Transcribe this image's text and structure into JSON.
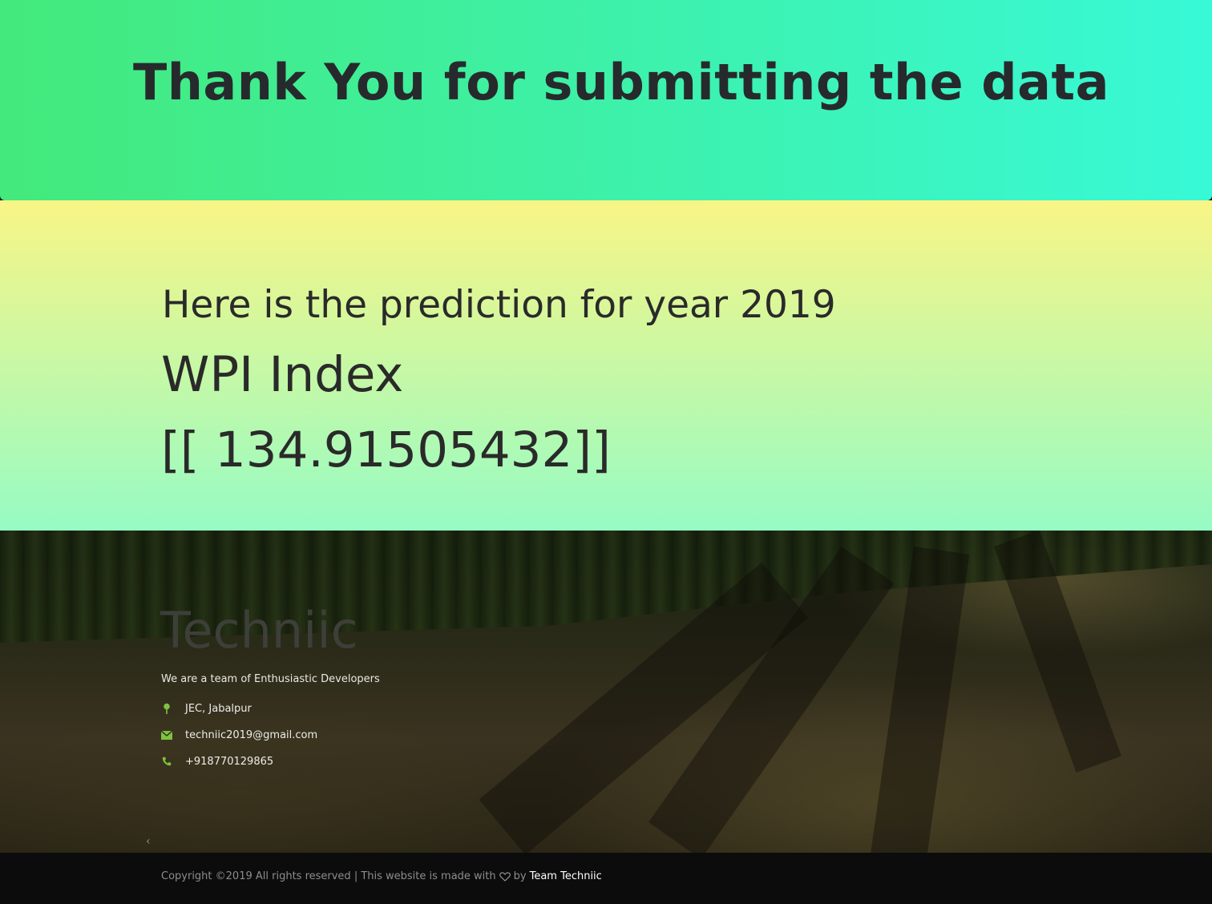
{
  "banner": {
    "title": "Thank You for submitting the data"
  },
  "prediction": {
    "intro": "Here is the prediction for year 2019",
    "label": "WPI Index",
    "value": "[[ 134.91505432]]"
  },
  "footer": {
    "brand": "Techniic",
    "tagline": "We are a team of Enthusiastic Developers",
    "contacts": [
      {
        "icon": "map-pin-icon",
        "text": "JEC, Jabalpur"
      },
      {
        "icon": "envelope-icon",
        "text": "techniic2019@gmail.com"
      },
      {
        "icon": "phone-icon",
        "text": "+918770129865"
      }
    ],
    "prev_arrow": "‹",
    "accent_color": "#7fc241"
  },
  "copyright": {
    "prefix": "Copyright ©2019 All rights reserved | This website is made with",
    "by": "by",
    "link_text": "Team Techniic"
  }
}
